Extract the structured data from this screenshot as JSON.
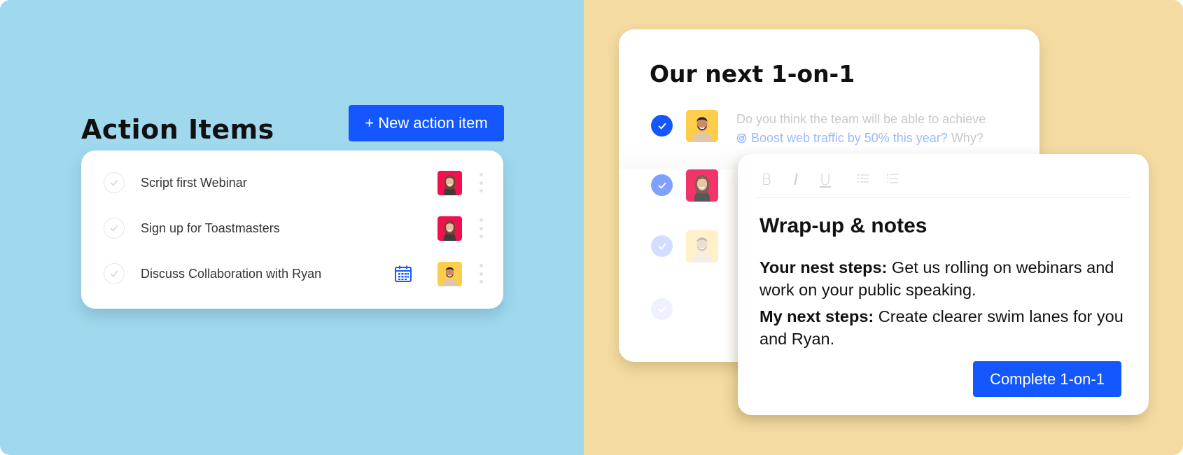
{
  "colors": {
    "left_bg": "#a0d9ee",
    "right_bg": "#f4dba2",
    "primary": "#1457ff",
    "goal_link": "#9bb9ff"
  },
  "action_items": {
    "title": "Action Items",
    "new_button_label": "+ New action item",
    "items": [
      {
        "label": "Script first Webinar",
        "assignee": "woman-pink-bg",
        "has_calendar": false
      },
      {
        "label": "Sign up for Toastmasters",
        "assignee": "woman-pink-bg",
        "has_calendar": false
      },
      {
        "label": "Discuss Collaboration with Ryan",
        "assignee": "man-yellow-bg",
        "has_calendar": true
      }
    ]
  },
  "one_on_one": {
    "title": "Our next 1-on-1",
    "question_prefix": "Do you think the team will be able to achieve",
    "goal_label": "Boost web traffic by 50% this year?",
    "question_suffix": " Why?",
    "agenda": [
      {
        "checked": true,
        "assignee": "man-yellow-bg"
      },
      {
        "checked": true,
        "assignee": "woman-pink-bg"
      },
      {
        "checked": true,
        "assignee": "man-yellow-bg"
      },
      {
        "checked": true,
        "assignee": null
      }
    ]
  },
  "notes": {
    "toolbar": [
      "bold",
      "italic",
      "underline",
      "bullet-list",
      "numbered-list"
    ],
    "toolbar_labels": {
      "bold": "B",
      "italic": "I",
      "underline": "U"
    },
    "title": "Wrap-up & notes",
    "your_label": "Your nest steps:",
    "your_text": " Get us rolling on webinars and work on your public speaking.",
    "my_label": "My next steps:",
    "my_text": " Create clearer swim lanes for you and Ryan.",
    "complete_button_label": "Complete 1-on-1"
  }
}
